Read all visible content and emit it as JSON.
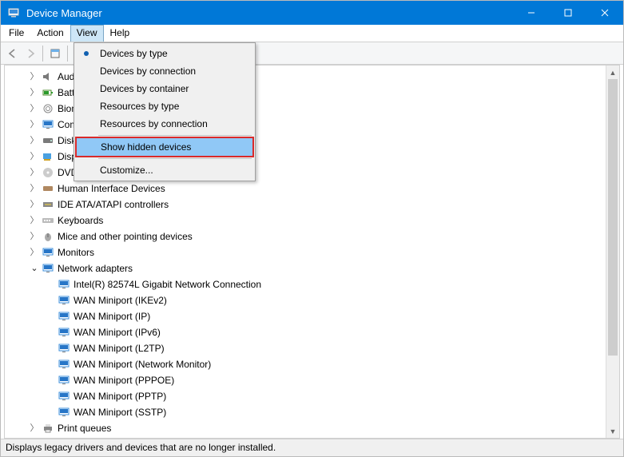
{
  "window": {
    "title": "Device Manager"
  },
  "menubar": {
    "file": "File",
    "action": "Action",
    "view": "View",
    "help": "Help"
  },
  "view_menu": {
    "devices_by_type": "Devices by type",
    "devices_by_connection": "Devices by connection",
    "devices_by_container": "Devices by container",
    "resources_by_type": "Resources by type",
    "resources_by_connection": "Resources by connection",
    "show_hidden_devices": "Show hidden devices",
    "customize": "Customize..."
  },
  "tree": {
    "audio": "Audi",
    "batteries": "Batte",
    "biometric": "Biom",
    "computer": "Com",
    "disk_drives": "Disk",
    "display": "Disp",
    "dvd": "DVD",
    "hid": "Human Interface Devices",
    "ide": "IDE ATA/ATAPI controllers",
    "keyboards": "Keyboards",
    "mice": "Mice and other pointing devices",
    "monitors": "Monitors",
    "network_adapters": "Network adapters",
    "net_children": [
      "Intel(R) 82574L Gigabit Network Connection",
      "WAN Miniport (IKEv2)",
      "WAN Miniport (IP)",
      "WAN Miniport (IPv6)",
      "WAN Miniport (L2TP)",
      "WAN Miniport (Network Monitor)",
      "WAN Miniport (PPPOE)",
      "WAN Miniport (PPTP)",
      "WAN Miniport (SSTP)"
    ],
    "print_queues": "Print queues"
  },
  "statusbar": {
    "text": "Displays legacy drivers and devices that are no longer installed."
  }
}
